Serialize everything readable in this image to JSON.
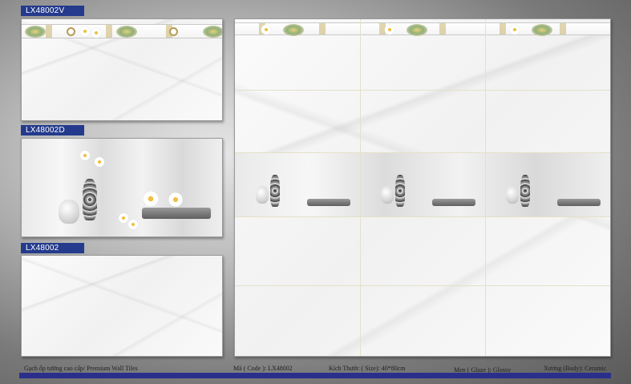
{
  "products": [
    {
      "code_label": "LX48002V"
    },
    {
      "code_label": "LX48002D"
    },
    {
      "code_label": "LX48002"
    }
  ],
  "footer": {
    "title": "Gạch ốp tường cao cấp/ Premium Wall Tiles",
    "code": "Mã ( Code ): LX48002",
    "size": "Kích Thước ( Size): 40*80cm",
    "glaze": "Men ( Glaze ): Glossy",
    "body": "Xương (Body): Ceramic"
  },
  "colors": {
    "label_bg": "#243a8c",
    "footer_bar": "#2b2f8c"
  }
}
